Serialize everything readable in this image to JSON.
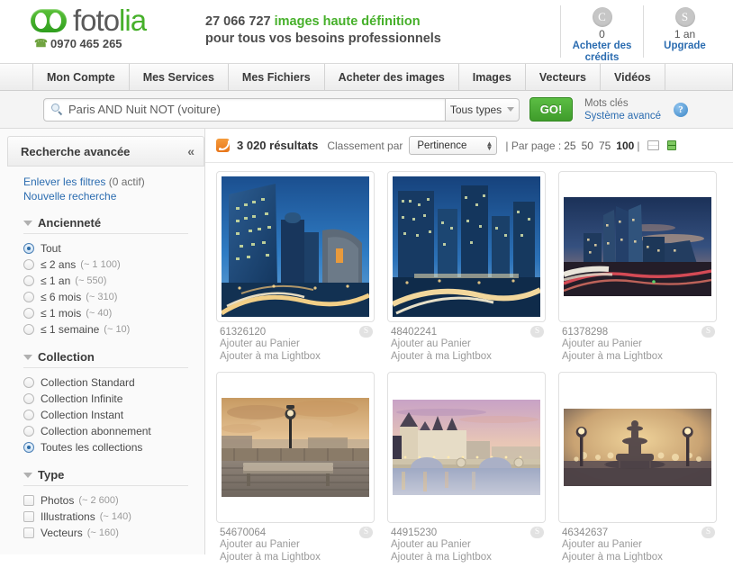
{
  "header": {
    "logo_text_dark": "foto",
    "logo_text_green": "lia",
    "phone": "0970 465 265",
    "tagline_count": "27 066 727",
    "tagline_green": "images haute définition",
    "tagline_line2": "pour tous vos besoins professionnels",
    "credits": {
      "badge": "C",
      "count": "0",
      "link_line1": "Acheter des",
      "link_line2": "crédits"
    },
    "subscription": {
      "badge": "S",
      "count": "1 an",
      "link_line1": "Upgrade"
    }
  },
  "nav": {
    "items": [
      {
        "label": "Mon Compte"
      },
      {
        "label": "Mes Services"
      },
      {
        "label": "Mes Fichiers"
      },
      {
        "label": "Acheter des images"
      },
      {
        "label": "Images"
      },
      {
        "label": "Vecteurs"
      },
      {
        "label": "Vidéos"
      }
    ]
  },
  "search": {
    "query": "Paris AND Nuit NOT (voiture)",
    "type_filter": "Tous types",
    "go_label": "GO!",
    "keywords_link": "Mots clés",
    "advanced_link": "Système avancé",
    "help_glyph": "?"
  },
  "sidebar": {
    "title": "Recherche avancée",
    "collapse_glyph": "«",
    "clear_filters": "Enlever les filtres",
    "clear_filters_count": "(0 actif)",
    "new_search": "Nouvelle recherche",
    "groups": [
      {
        "title": "Ancienneté",
        "control": "radio",
        "options": [
          {
            "label": "Tout",
            "count": "",
            "selected": true
          },
          {
            "label": "≤ 2 ans",
            "count": "(~ 1 100)",
            "selected": false
          },
          {
            "label": "≤ 1 an",
            "count": "(~ 550)",
            "selected": false
          },
          {
            "label": "≤ 6 mois",
            "count": "(~ 310)",
            "selected": false
          },
          {
            "label": "≤ 1 mois",
            "count": "(~ 40)",
            "selected": false
          },
          {
            "label": "≤ 1 semaine",
            "count": "(~ 10)",
            "selected": false
          }
        ]
      },
      {
        "title": "Collection",
        "control": "radio",
        "options": [
          {
            "label": "Collection Standard",
            "count": "",
            "selected": false
          },
          {
            "label": "Collection Infinite",
            "count": "",
            "selected": false
          },
          {
            "label": "Collection Instant",
            "count": "",
            "selected": false
          },
          {
            "label": "Collection abonnement",
            "count": "",
            "selected": false
          },
          {
            "label": "Toutes les collections",
            "count": "",
            "selected": true
          }
        ]
      },
      {
        "title": "Type",
        "control": "checkbox",
        "options": [
          {
            "label": "Photos",
            "count": "(~ 2 600)",
            "selected": false
          },
          {
            "label": "Illustrations",
            "count": "(~ 140)",
            "selected": false
          },
          {
            "label": "Vecteurs",
            "count": "(~ 160)",
            "selected": false
          }
        ]
      }
    ]
  },
  "results": {
    "count_label": "3 020 résultats",
    "sort_label": "Classement par",
    "sort_value": "Pertinence",
    "per_page_label": "| Par page :",
    "per_page_options": [
      "25",
      "50",
      "75",
      "100"
    ],
    "per_page_active": "100",
    "per_page_end": "|",
    "items": [
      {
        "id": "61326120",
        "cart": "Ajouter au Panier",
        "lightbox": "Ajouter à ma Lightbox",
        "badge": "S",
        "art": "ladefense-towers"
      },
      {
        "id": "48402241",
        "cart": "Ajouter au Panier",
        "lightbox": "Ajouter à ma Lightbox",
        "badge": "S",
        "art": "ladefense-plaza"
      },
      {
        "id": "61378298",
        "cart": "Ajouter au Panier",
        "lightbox": "Ajouter à ma Lightbox",
        "badge": "S",
        "art": "ladefense-dusk"
      },
      {
        "id": "54670064",
        "cart": "Ajouter au Panier",
        "lightbox": "Ajouter à ma Lightbox",
        "badge": "S",
        "art": "bench-seine"
      },
      {
        "id": "44915230",
        "cart": "Ajouter au Panier",
        "lightbox": "Ajouter à ma Lightbox",
        "badge": "S",
        "art": "conciergerie-bridge"
      },
      {
        "id": "46342637",
        "cart": "Ajouter au Panier",
        "lightbox": "Ajouter à ma Lightbox",
        "badge": "S",
        "art": "concorde-fountain"
      }
    ]
  },
  "colors": {
    "brand_green": "#46b02a",
    "link_blue": "#2b6cb0",
    "rss_orange": "#e8761a"
  }
}
